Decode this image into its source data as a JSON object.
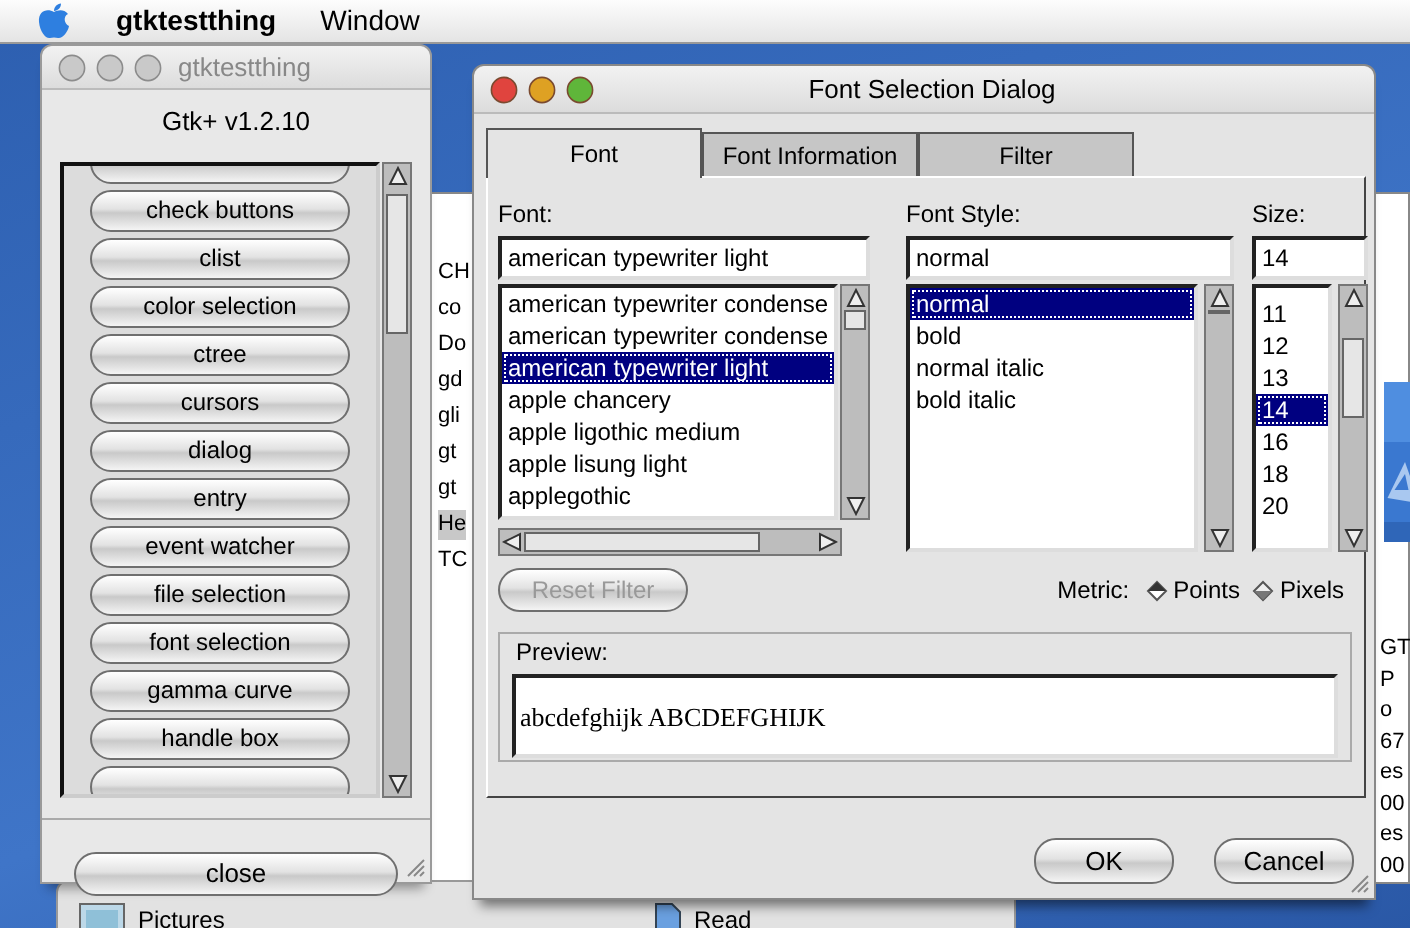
{
  "menu_bar": {
    "app_name": "gtktestthing",
    "menus": [
      "Window"
    ]
  },
  "background_window": {
    "left_lines": [
      {
        "text": "CH",
        "selected": false
      },
      {
        "text": "co",
        "selected": false
      },
      {
        "text": "Do",
        "selected": false
      },
      {
        "text": "gd",
        "selected": false
      },
      {
        "text": "gli",
        "selected": false
      },
      {
        "text": "gt",
        "selected": false
      },
      {
        "text": "gt",
        "selected": false
      },
      {
        "text": "He",
        "selected": true
      },
      {
        "text": "TC",
        "selected": false
      }
    ],
    "right_lines": [
      "GT",
      "P",
      "o",
      "67",
      "es",
      "00",
      "es",
      "00"
    ]
  },
  "finder_window": {
    "items": [
      "Pictures",
      "Read"
    ]
  },
  "test_window": {
    "title": "gtktestthing",
    "active": false,
    "version": "Gtk+ v1.2.10",
    "buttons": [
      "check buttons",
      "clist",
      "color selection",
      "ctree",
      "cursors",
      "dialog",
      "entry",
      "event watcher",
      "file selection",
      "font selection",
      "gamma curve",
      "handle box"
    ],
    "close_button": "close"
  },
  "dialog": {
    "title": "Font Selection Dialog",
    "active": true,
    "tabs": [
      {
        "label": "Font",
        "selected": true
      },
      {
        "label": "Font Information",
        "selected": false
      },
      {
        "label": "Filter",
        "selected": false
      }
    ],
    "font": {
      "label": "Font:",
      "value": "american typewriter light",
      "items": [
        {
          "text": "american typewriter condense",
          "selected": false
        },
        {
          "text": "american typewriter condense",
          "selected": false
        },
        {
          "text": "american typewriter light",
          "selected": true
        },
        {
          "text": "apple chancery",
          "selected": false
        },
        {
          "text": "apple ligothic medium",
          "selected": false
        },
        {
          "text": "apple lisung light",
          "selected": false
        },
        {
          "text": "applegothic",
          "selected": false
        }
      ]
    },
    "style": {
      "label": "Font Style:",
      "value": "normal",
      "items": [
        {
          "text": "normal",
          "selected": true
        },
        {
          "text": "bold",
          "selected": false
        },
        {
          "text": "normal italic",
          "selected": false
        },
        {
          "text": "bold italic",
          "selected": false
        }
      ]
    },
    "size": {
      "label": "Size:",
      "value": "14",
      "items": [
        {
          "text": "11",
          "selected": false
        },
        {
          "text": "12",
          "selected": false
        },
        {
          "text": "13",
          "selected": false
        },
        {
          "text": "14",
          "selected": true
        },
        {
          "text": "16",
          "selected": false
        },
        {
          "text": "18",
          "selected": false
        },
        {
          "text": "20",
          "selected": false
        }
      ]
    },
    "reset_button": {
      "label": "Reset Filter",
      "disabled": true
    },
    "metric": {
      "label": "Metric:",
      "options": [
        {
          "label": "Points",
          "selected": true
        },
        {
          "label": "Pixels",
          "selected": false
        }
      ]
    },
    "preview": {
      "label": "Preview:",
      "text": "abcdefghijk ABCDEFGHIJK"
    },
    "buttons": [
      "OK",
      "Cancel"
    ]
  }
}
